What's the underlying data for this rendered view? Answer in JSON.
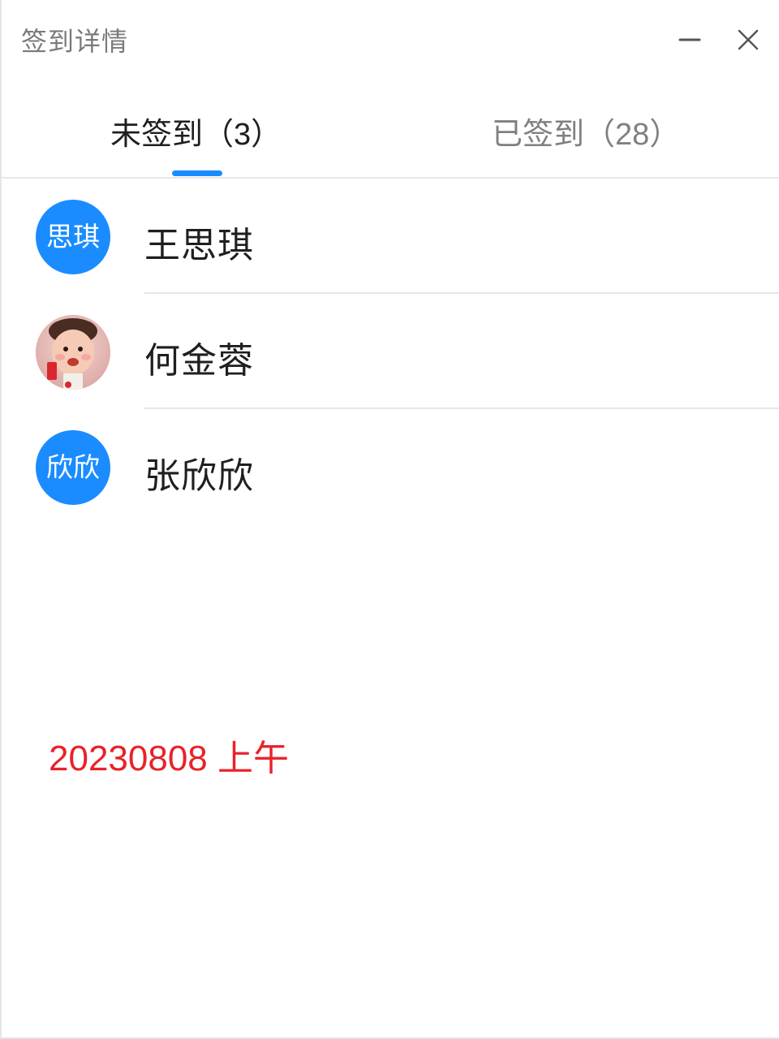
{
  "window": {
    "title": "签到详情"
  },
  "tabs": [
    {
      "label": "未签到（3）",
      "active": true
    },
    {
      "label": "已签到（28）",
      "active": false
    }
  ],
  "list": [
    {
      "avatar_text": "思琪",
      "name": "王思琪",
      "avatar_type": "initials"
    },
    {
      "avatar_text": "",
      "name": "何金蓉",
      "avatar_type": "photo"
    },
    {
      "avatar_text": "欣欣",
      "name": "张欣欣",
      "avatar_type": "initials"
    }
  ],
  "note": "20230808 上午",
  "colors": {
    "accent": "#1a8cff",
    "note_red": "#e8222a"
  }
}
